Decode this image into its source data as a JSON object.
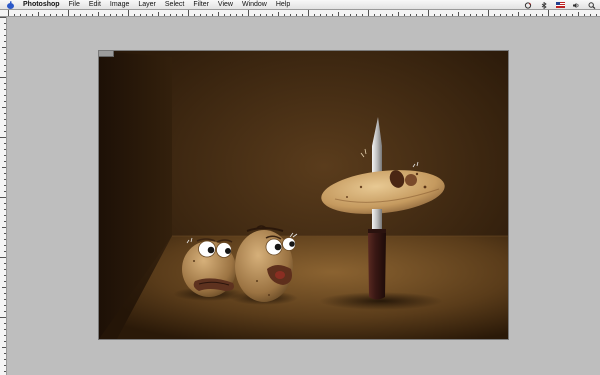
{
  "menubar": {
    "app_name": "Photoshop",
    "items": [
      "File",
      "Edit",
      "Image",
      "Layer",
      "Select",
      "Filter",
      "View",
      "Window",
      "Help"
    ],
    "status_icons": [
      "sync-icon",
      "bluetooth-icon",
      "flag-icon",
      "volume-icon",
      "search-icon"
    ]
  },
  "colors": {
    "menubar_bg": "#ececec",
    "workspace_bg": "#bebebe",
    "scene_wall": "#3b2612",
    "scene_floor": "#6e4a23",
    "potato": "#a07c4a",
    "knife_handle": "#3a1a16"
  }
}
